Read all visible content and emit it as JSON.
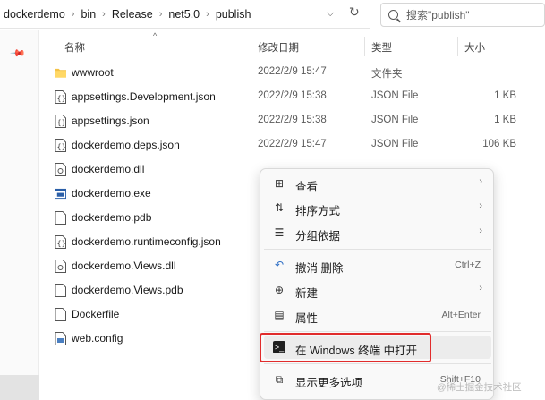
{
  "address": {
    "segments": [
      "dockerdemo",
      "bin",
      "Release",
      "net5.0",
      "publish"
    ],
    "chevron_icon": "chevron-down-icon",
    "refresh_icon": "refresh-icon"
  },
  "search": {
    "placeholder": "搜索\"publish\""
  },
  "columns": {
    "name": "名称",
    "date": "修改日期",
    "type": "类型",
    "size": "大小"
  },
  "files": [
    {
      "name": "wwwroot",
      "date": "2022/2/9 15:47",
      "type": "文件夹",
      "size": "",
      "icon": "folder-icon"
    },
    {
      "name": "appsettings.Development.json",
      "date": "2022/2/9 15:38",
      "type": "JSON File",
      "size": "1 KB",
      "icon": "json-file-icon"
    },
    {
      "name": "appsettings.json",
      "date": "2022/2/9 15:38",
      "type": "JSON File",
      "size": "1 KB",
      "icon": "json-file-icon"
    },
    {
      "name": "dockerdemo.deps.json",
      "date": "2022/2/9 15:47",
      "type": "JSON File",
      "size": "106 KB",
      "icon": "json-file-icon"
    },
    {
      "name": "dockerdemo.dll",
      "date": "",
      "type": "",
      "size": "",
      "icon": "dll-file-icon"
    },
    {
      "name": "dockerdemo.exe",
      "date": "",
      "type": "",
      "size": "",
      "icon": "exe-file-icon"
    },
    {
      "name": "dockerdemo.pdb",
      "date": "",
      "type": "",
      "size": "",
      "icon": "file-icon"
    },
    {
      "name": "dockerdemo.runtimeconfig.json",
      "date": "",
      "type": "",
      "size": "",
      "icon": "json-file-icon"
    },
    {
      "name": "dockerdemo.Views.dll",
      "date": "",
      "type": "",
      "size": "",
      "icon": "dll-file-icon"
    },
    {
      "name": "dockerdemo.Views.pdb",
      "date": "",
      "type": "",
      "size": "",
      "icon": "file-icon"
    },
    {
      "name": "Dockerfile",
      "date": "",
      "type": "",
      "size": "",
      "icon": "file-icon"
    },
    {
      "name": "web.config",
      "date": "",
      "type": "",
      "size": "",
      "icon": "config-file-icon"
    }
  ],
  "menu": {
    "view": "查看",
    "sort": "排序方式",
    "group": "分组依据",
    "undo": "撤消 删除",
    "undo_key": "Ctrl+Z",
    "new": "新建",
    "props": "属性",
    "props_key": "Alt+Enter",
    "terminal": "在 Windows 终端 中打开",
    "more": "显示更多选项",
    "more_key": "Shift+F10"
  },
  "watermark": "@稀土掘金技术社区",
  "colors": {
    "highlight": "#e12c2c",
    "folder": "#f4c246",
    "menu_bg": "#f9f9f9"
  }
}
